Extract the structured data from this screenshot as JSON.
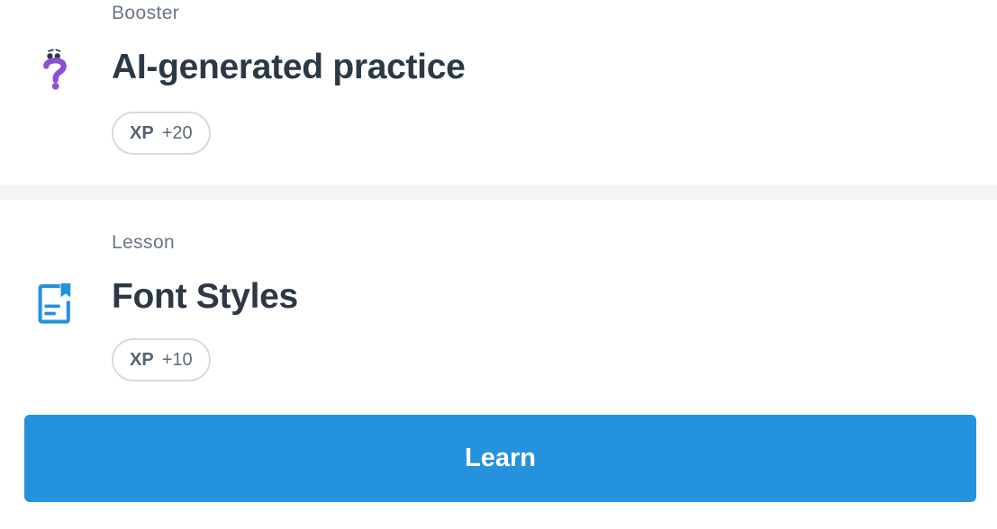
{
  "items": [
    {
      "type_label": "Booster",
      "title": "AI-generated practice",
      "xp_key": "XP",
      "xp_value": "+20",
      "icon": "question-mark-icon",
      "icon_color": "#8a4fd6"
    },
    {
      "type_label": "Lesson",
      "title": "Font Styles",
      "xp_key": "XP",
      "xp_value": "+10",
      "icon": "lesson-document-icon",
      "icon_color": "#2492dd"
    }
  ],
  "learn_button": {
    "label": "Learn",
    "color": "#2492dd"
  }
}
